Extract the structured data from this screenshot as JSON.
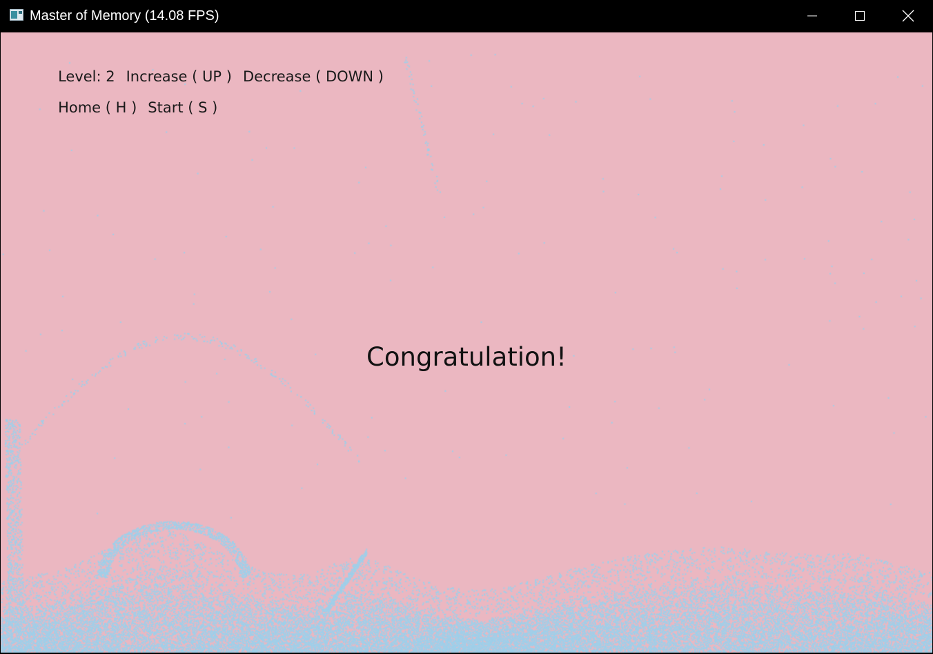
{
  "window": {
    "title": "Master of Memory (14.08 FPS)",
    "app_icon": "app-window-icon",
    "controls": {
      "minimize_icon": "minimize-icon",
      "maximize_icon": "maximize-icon",
      "close_icon": "close-icon"
    }
  },
  "hud": {
    "level": "Level: 2",
    "increase": "Increase ( UP )",
    "decrease": "Decrease ( DOWN )",
    "home": "Home ( H )",
    "start": "Start ( S )"
  },
  "message": "Congratulation!",
  "colors": {
    "background": "#ebb7c1",
    "particles": "#9fcfe9",
    "text": "#1a1a1a",
    "titlebar": "#000000"
  }
}
